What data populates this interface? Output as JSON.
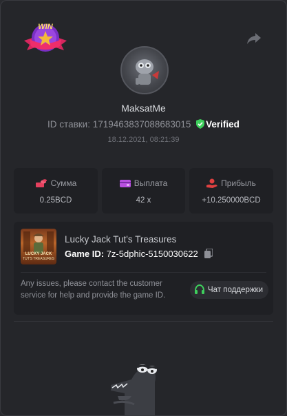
{
  "badge": {
    "text": "WIN"
  },
  "player": {
    "username": "MaksatMe",
    "bet_id_label": "ID ставки:",
    "bet_id": "1719463837088683015",
    "verified_label": "Verified",
    "datetime": "18.12.2021, 08:21:39"
  },
  "stats": [
    {
      "label": "Сумма",
      "value": "0.25BCD",
      "icon": "coins-icon",
      "color": "#e5405e"
    },
    {
      "label": "Выплата",
      "value": "42 x",
      "icon": "wallet-icon",
      "color": "#b84fe0"
    },
    {
      "label": "Прибыль",
      "value": "+10.250000BCD",
      "icon": "hand-coin-icon",
      "color": "#e04040"
    }
  ],
  "game": {
    "thumb_line1": "LUCKY JACK",
    "thumb_line2": "TUT'S TREASURES",
    "title": "Lucky Jack Tut's Treasures",
    "id_label": "Game ID:",
    "id_value": "7z-5dphic-5150030622",
    "help_text": "Any issues, please contact the customer service for help and provide the game ID.",
    "support_label": "Чат поддержки"
  },
  "colors": {
    "verified": "#3ecf5c",
    "support_icon": "#3ecf5c"
  }
}
